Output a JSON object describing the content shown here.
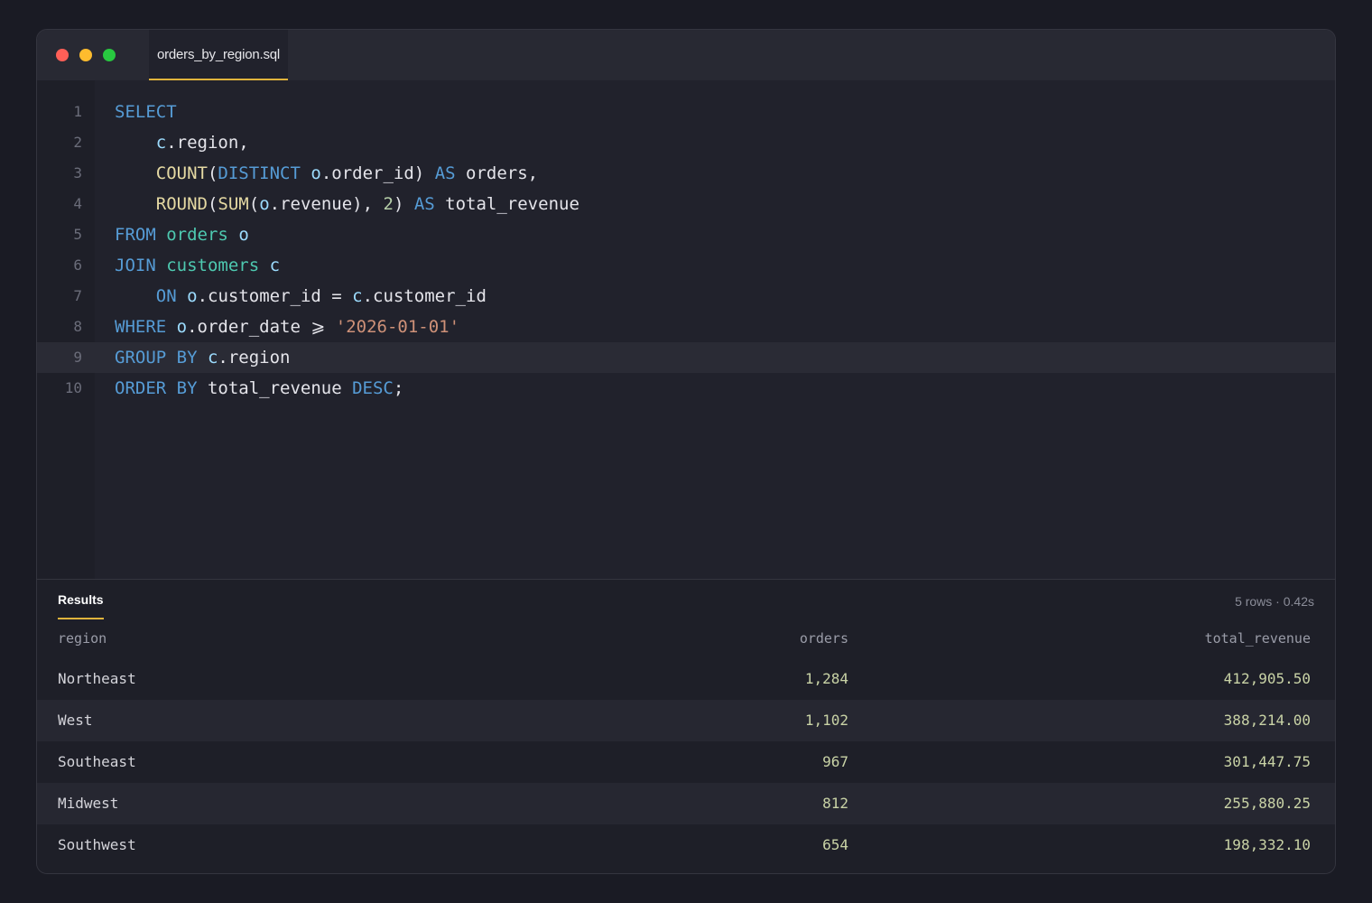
{
  "window": {
    "tab_title": "orders_by_region.sql"
  },
  "editor": {
    "line_numbers": [
      "1",
      "2",
      "3",
      "4",
      "5",
      "6",
      "7",
      "8",
      "9",
      "10"
    ],
    "highlighted_line": 9,
    "code_lines": [
      "SELECT",
      "    c.region,",
      "    COUNT(DISTINCT o.order_id) AS orders,",
      "    ROUND(SUM(o.revenue), 2) AS total_revenue",
      "FROM orders o",
      "JOIN customers c",
      "    ON o.customer_id = c.customer_id",
      "WHERE o.order_date ⩾ '2026-01-01'",
      "GROUP BY c.region",
      "ORDER BY total_revenue DESC;"
    ]
  },
  "results": {
    "tab_label": "Results",
    "meta": "5 rows · 0.42s",
    "columns": [
      "region",
      "orders",
      "total_revenue"
    ],
    "rows": [
      [
        "Northeast",
        "1,284",
        "412,905.50"
      ],
      [
        "West",
        "1,102",
        "388,214.00"
      ],
      [
        "Southeast",
        "967",
        "301,447.75"
      ],
      [
        "Midwest",
        "812",
        "255,880.25"
      ],
      [
        "Southwest",
        "654",
        "198,332.10"
      ]
    ]
  },
  "colors": {
    "accent": "#e0b43c",
    "keyword": "#569cd6",
    "function": "#e5d9a3",
    "table": "#4ec9b0",
    "string": "#ce9178",
    "number": "#b5cea8"
  }
}
